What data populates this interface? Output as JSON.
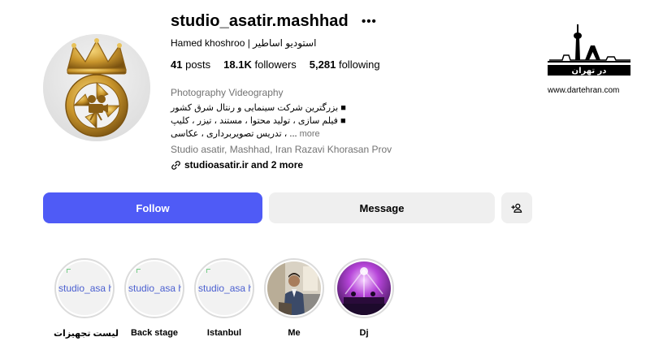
{
  "profile": {
    "username": "studio_asatir.mashhad",
    "more_icon": "•••",
    "full_name": "Hamed khoshroo | استودیو اساطیر",
    "stats": [
      {
        "value": "41",
        "label": "posts"
      },
      {
        "value": "18.1K",
        "label": "followers"
      },
      {
        "value": "5,281",
        "label": "following"
      }
    ],
    "category": "Photography Videography",
    "bio": [
      "بزرگترین شرکت سینمایی و رنتال شرق کشور ■",
      "فیلم سازی ، تولید محتوا ، مستند ، تیزر ، کلیپ ■",
      "تدریس تصویربرداری ، عکاسی ، ..."
    ],
    "bio_more": "more",
    "location": "Studio asatir, Mashhad, Iran Razavi Khorasan Prov",
    "link_text": "studioasatir.ir and 2 more"
  },
  "actions": {
    "follow": "Follow",
    "message": "Message",
    "add_user_icon": "add-person-icon"
  },
  "highlights": [
    {
      "label": "لیست تجهیزات",
      "broken_text": "studio_asa highlight st"
    },
    {
      "label": "Back stage",
      "broken_text": "studio_asa highlight st"
    },
    {
      "label": "Istanbul",
      "broken_text": "studio_asa highlight st"
    },
    {
      "label": "Me"
    },
    {
      "label": "Dj"
    }
  ],
  "watermark": {
    "logo_text": "در تهران",
    "url": "www.dartehran.com"
  },
  "colors": {
    "follow_button": "#4f5bf6",
    "secondary_button": "#efefef",
    "muted_text": "#737373"
  }
}
